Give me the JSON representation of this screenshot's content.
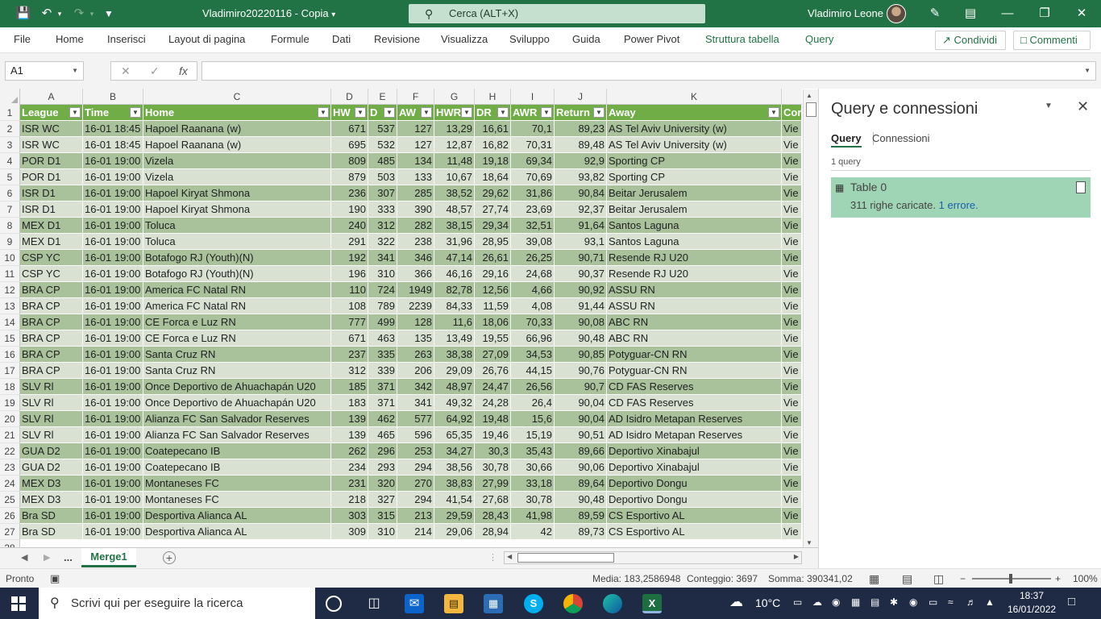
{
  "window": {
    "doc_title": "Vladimiro20220116 - Copia",
    "title_caret": "▾",
    "search_placeholder": "Cerca (ALT+X)",
    "user": "Vladimiro Leone"
  },
  "ribbon": {
    "tabs": [
      "File",
      "Home",
      "Inserisci",
      "Layout di pagina",
      "Formule",
      "Dati",
      "Revisione",
      "Visualizza",
      "Sviluppo",
      "Guida",
      "Power Pivot",
      "Struttura tabella",
      "Query"
    ],
    "share": "Condividi",
    "comments": "Commenti"
  },
  "formula_bar": {
    "name_box": "A1",
    "fx": "fx",
    "cancel": "✕",
    "enter": "✓",
    "value": ""
  },
  "grid": {
    "columns": [
      "A",
      "B",
      "C",
      "D",
      "E",
      "F",
      "G",
      "H",
      "I",
      "J",
      "K"
    ],
    "headers": [
      "League",
      "Time",
      "Home",
      "HW",
      "D",
      "AW",
      "HWR",
      "DR",
      "AWR",
      "Return",
      "Away",
      "Cor"
    ],
    "row_numbers": [
      "1",
      "2",
      "3",
      "4",
      "5",
      "6",
      "7",
      "8",
      "9",
      "10",
      "11",
      "12",
      "13",
      "14",
      "15",
      "16",
      "17",
      "18",
      "19",
      "20",
      "21",
      "22",
      "23",
      "24",
      "25",
      "26",
      "27",
      "28"
    ],
    "rows": [
      [
        "ISR WC",
        "16-01 18:45",
        "Hapoel Raanana (w)",
        "671",
        "537",
        "127",
        "13,29",
        "16,61",
        "70,1",
        "89,23",
        "AS Tel Aviv University (w)",
        "Vie"
      ],
      [
        "ISR WC",
        "16-01 18:45",
        "Hapoel Raanana (w)",
        "695",
        "532",
        "127",
        "12,87",
        "16,82",
        "70,31",
        "89,48",
        "AS Tel Aviv University (w)",
        "Vie"
      ],
      [
        "POR D1",
        "16-01 19:00",
        "Vizela",
        "809",
        "485",
        "134",
        "11,48",
        "19,18",
        "69,34",
        "92,9",
        "Sporting CP",
        "Vie"
      ],
      [
        "POR D1",
        "16-01 19:00",
        "Vizela",
        "879",
        "503",
        "133",
        "10,67",
        "18,64",
        "70,69",
        "93,82",
        "Sporting CP",
        "Vie"
      ],
      [
        "ISR D1",
        "16-01 19:00",
        "Hapoel Kiryat Shmona",
        "236",
        "307",
        "285",
        "38,52",
        "29,62",
        "31,86",
        "90,84",
        "Beitar Jerusalem",
        "Vie"
      ],
      [
        "ISR D1",
        "16-01 19:00",
        "Hapoel Kiryat Shmona",
        "190",
        "333",
        "390",
        "48,57",
        "27,74",
        "23,69",
        "92,37",
        "Beitar Jerusalem",
        "Vie"
      ],
      [
        "MEX D1",
        "16-01 19:00",
        "Toluca",
        "240",
        "312",
        "282",
        "38,15",
        "29,34",
        "32,51",
        "91,64",
        "Santos Laguna",
        "Vie"
      ],
      [
        "MEX D1",
        "16-01 19:00",
        "Toluca",
        "291",
        "322",
        "238",
        "31,96",
        "28,95",
        "39,08",
        "93,1",
        "Santos Laguna",
        "Vie"
      ],
      [
        "CSP YC",
        "16-01 19:00",
        "Botafogo RJ (Youth)(N)",
        "192",
        "341",
        "346",
        "47,14",
        "26,61",
        "26,25",
        "90,71",
        "Resende RJ U20",
        "Vie"
      ],
      [
        "CSP YC",
        "16-01 19:00",
        "Botafogo RJ (Youth)(N)",
        "196",
        "310",
        "366",
        "46,16",
        "29,16",
        "24,68",
        "90,37",
        "Resende RJ U20",
        "Vie"
      ],
      [
        "BRA CP",
        "16-01 19:00",
        "America FC Natal RN",
        "110",
        "724",
        "1949",
        "82,78",
        "12,56",
        "4,66",
        "90,92",
        "ASSU RN",
        "Vie"
      ],
      [
        "BRA CP",
        "16-01 19:00",
        "America FC Natal RN",
        "108",
        "789",
        "2239",
        "84,33",
        "11,59",
        "4,08",
        "91,44",
        "ASSU RN",
        "Vie"
      ],
      [
        "BRA CP",
        "16-01 19:00",
        "CE Forca e Luz RN",
        "777",
        "499",
        "128",
        "11,6",
        "18,06",
        "70,33",
        "90,08",
        "ABC RN",
        "Vie"
      ],
      [
        "BRA CP",
        "16-01 19:00",
        "CE Forca e Luz RN",
        "671",
        "463",
        "135",
        "13,49",
        "19,55",
        "66,96",
        "90,48",
        "ABC RN",
        "Vie"
      ],
      [
        "BRA CP",
        "16-01 19:00",
        "Santa Cruz RN",
        "237",
        "335",
        "263",
        "38,38",
        "27,09",
        "34,53",
        "90,85",
        "Potyguar-CN RN",
        "Vie"
      ],
      [
        "BRA CP",
        "16-01 19:00",
        "Santa Cruz RN",
        "312",
        "339",
        "206",
        "29,09",
        "26,76",
        "44,15",
        "90,76",
        "Potyguar-CN RN",
        "Vie"
      ],
      [
        "SLV Rl",
        "16-01 19:00",
        "Once Deportivo de Ahuachapán U20",
        "185",
        "371",
        "342",
        "48,97",
        "24,47",
        "26,56",
        "90,7",
        "CD FAS Reserves",
        "Vie"
      ],
      [
        "SLV Rl",
        "16-01 19:00",
        "Once Deportivo de Ahuachapán U20",
        "183",
        "371",
        "341",
        "49,32",
        "24,28",
        "26,4",
        "90,04",
        "CD FAS Reserves",
        "Vie"
      ],
      [
        "SLV Rl",
        "16-01 19:00",
        "Alianza FC San Salvador Reserves",
        "139",
        "462",
        "577",
        "64,92",
        "19,48",
        "15,6",
        "90,04",
        "AD Isidro Metapan Reserves",
        "Vie"
      ],
      [
        "SLV Rl",
        "16-01 19:00",
        "Alianza FC San Salvador Reserves",
        "139",
        "465",
        "596",
        "65,35",
        "19,46",
        "15,19",
        "90,51",
        "AD Isidro Metapan Reserves",
        "Vie"
      ],
      [
        "GUA D2",
        "16-01 19:00",
        "Coatepecano IB",
        "262",
        "296",
        "253",
        "34,27",
        "30,3",
        "35,43",
        "89,66",
        "Deportivo Xinabajul",
        "Vie"
      ],
      [
        "GUA D2",
        "16-01 19:00",
        "Coatepecano IB",
        "234",
        "293",
        "294",
        "38,56",
        "30,78",
        "30,66",
        "90,06",
        "Deportivo Xinabajul",
        "Vie"
      ],
      [
        "MEX D3",
        "16-01 19:00",
        "Montaneses FC",
        "231",
        "320",
        "270",
        "38,83",
        "27,99",
        "33,18",
        "89,64",
        "Deportivo Dongu",
        "Vie"
      ],
      [
        "MEX D3",
        "16-01 19:00",
        "Montaneses FC",
        "218",
        "327",
        "294",
        "41,54",
        "27,68",
        "30,78",
        "90,48",
        "Deportivo Dongu",
        "Vie"
      ],
      [
        "Bra SD",
        "16-01 19:00",
        "Desportiva Alianca AL",
        "303",
        "315",
        "213",
        "29,59",
        "28,43",
        "41,98",
        "89,59",
        "CS Esportivo AL",
        "Vie"
      ],
      [
        "Bra SD",
        "16-01 19:00",
        "Desportiva Alianca AL",
        "309",
        "310",
        "214",
        "29,06",
        "28,94",
        "42",
        "89,73",
        "CS Esportivo AL",
        "Vie"
      ]
    ]
  },
  "sheets": {
    "ellipsis": "...",
    "active": "Merge1",
    "add": "+"
  },
  "status": {
    "mode": "Pronto",
    "average": "Media: 183,2586948",
    "count": "Conteggio: 3697",
    "sum": "Somma: 390341,02",
    "zoom": "100%",
    "minus": "−",
    "plus": "+"
  },
  "query_pane": {
    "title": "Query e connessioni",
    "tab_query": "Query",
    "tab_connections": "Connessioni",
    "count": "1 query",
    "item_name": "Table 0",
    "item_status": "311 righe caricate.",
    "item_error": "1 errore."
  },
  "taskbar": {
    "search_placeholder": "Scrivi qui per eseguire la ricerca",
    "temperature": "10°C",
    "time": "18:37",
    "date": "16/01/2022"
  },
  "colors": {
    "excel_green": "#217346",
    "table_header": "#70ad47",
    "band_dark": "#a9c29b",
    "band_light": "#d9e2d2",
    "query_card": "#9fd5b5",
    "taskbar": "#1f2b45"
  }
}
